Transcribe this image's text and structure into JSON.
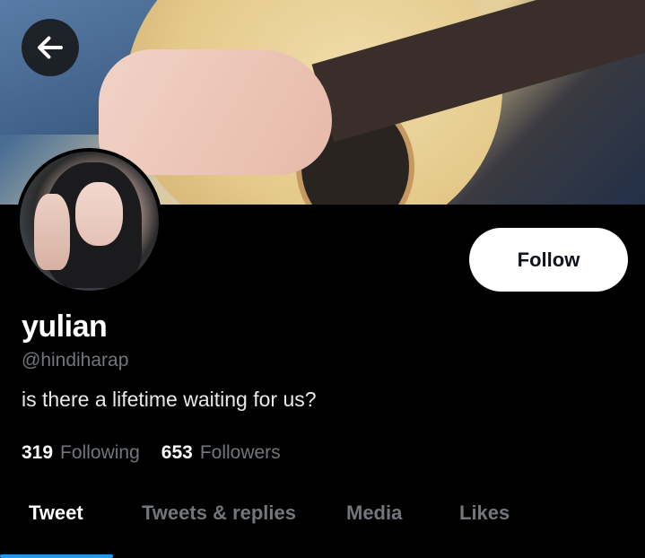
{
  "profile": {
    "display_name": "yulian",
    "handle": "@hindiharap",
    "bio": "is there a lifetime waiting for us?"
  },
  "stats": {
    "following_count": "319",
    "following_label": "Following",
    "followers_count": "653",
    "followers_label": "Followers"
  },
  "actions": {
    "follow_label": "Follow"
  },
  "tabs": [
    {
      "label": "Tweet",
      "active": true
    },
    {
      "label": "Tweets & replies",
      "active": false
    },
    {
      "label": "Media",
      "active": false
    },
    {
      "label": "Likes",
      "active": false
    }
  ],
  "icons": {
    "back": "arrow-left-icon"
  },
  "colors": {
    "accent": "#1d9bf0",
    "background": "#000000",
    "muted_text": "#71767b"
  }
}
